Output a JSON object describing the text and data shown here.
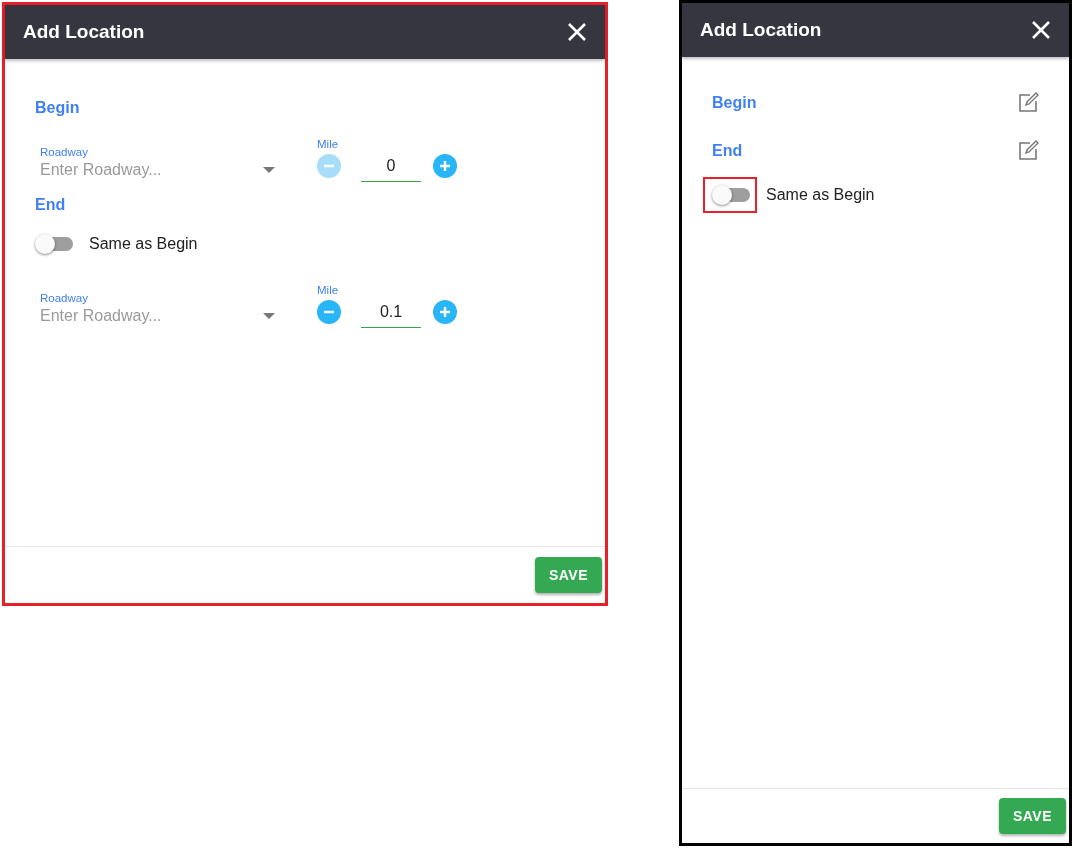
{
  "dialogs": [
    {
      "kind": "form",
      "title": "Add Location",
      "highlighted": true,
      "sections": [
        {
          "heading": "Begin",
          "fields": {
            "roadway_label": "Roadway",
            "roadway_placeholder": "Enter Roadway...",
            "mile_label": "Mile",
            "mile_value": "0",
            "minus_disabled": true
          }
        },
        {
          "heading": "End",
          "toggle": {
            "label": "Same as Begin",
            "on": false
          },
          "toggle_outlined": false,
          "fields": {
            "roadway_label": "Roadway",
            "roadway_placeholder": "Enter Roadway...",
            "mile_label": "Mile",
            "mile_value": "0.1",
            "minus_disabled": false
          }
        }
      ],
      "save": "SAVE"
    },
    {
      "kind": "summary",
      "title": "Add Location",
      "highlighted": false,
      "sections": [
        {
          "heading": "Begin"
        },
        {
          "heading": "End",
          "toggle": {
            "label": "Same as Begin",
            "on": false
          },
          "toggle_outlined": true
        }
      ],
      "save": "SAVE"
    }
  ]
}
